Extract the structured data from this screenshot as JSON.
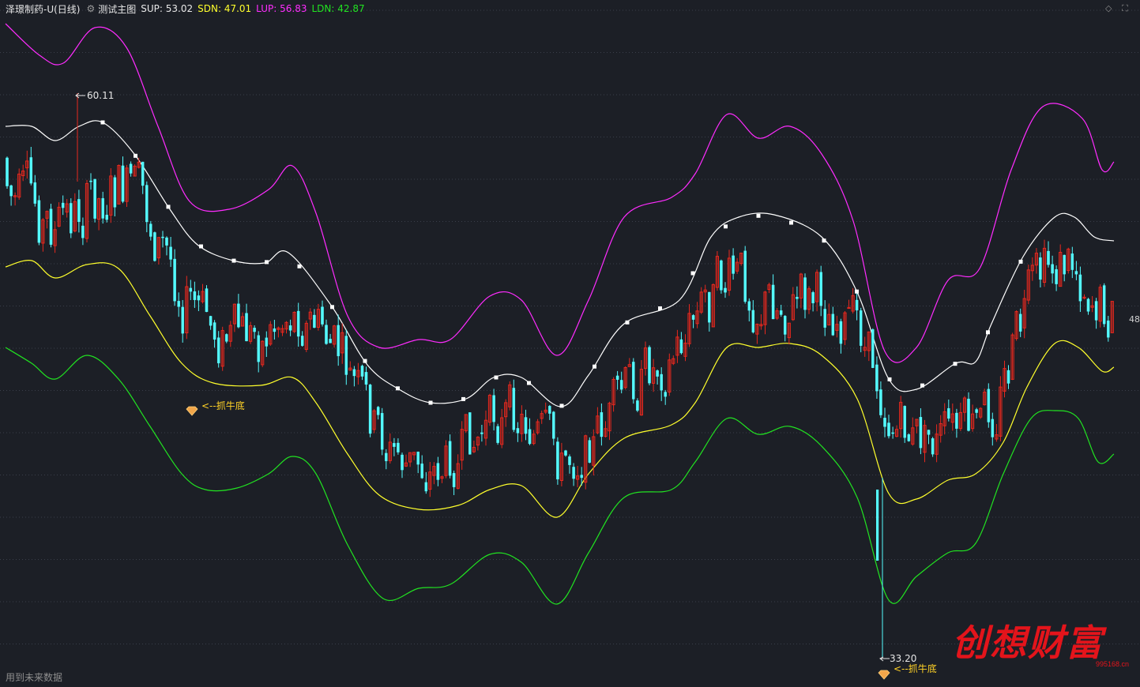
{
  "header": {
    "title": "泽璟制药-U(日线)",
    "indicator_name": "测试主图",
    "sup": "SUP: 53.02",
    "sdn": "SDN: 47.01",
    "lup": "LUP: 56.83",
    "ldn": "LDN: 42.87"
  },
  "footer_text": "用到未来数据",
  "axis_tag": "48",
  "watermark": {
    "text": "创想财富",
    "url": "995168.cn"
  },
  "corner_icons": [
    "diamond-icon",
    "fullscreen-icon"
  ],
  "colors": {
    "background": "#1c1f26",
    "up": "#e8281e",
    "down": "#54fbff",
    "sup": "#ffffff",
    "sdn": "#ffff2c",
    "lup": "#ff2cff",
    "ldn": "#21e321",
    "grid": "#3a3f4a"
  },
  "chart_data": {
    "type": "candlestick",
    "visible_range": {
      "high": 60.11,
      "low": 33.2
    },
    "annotations": [
      {
        "text": "60.11",
        "kind": "high-price-label"
      },
      {
        "text": "33.20",
        "kind": "low-price-label"
      },
      {
        "text": "<--抓牛底",
        "kind": "buy-signal",
        "near": "bottom-1"
      },
      {
        "text": "<--抓牛底",
        "kind": "buy-signal",
        "near": "bottom-2"
      }
    ],
    "series_latest": {
      "SUP": 53.02,
      "SDN": 47.01,
      "LUP": 56.83,
      "LDN": 42.87
    }
  }
}
